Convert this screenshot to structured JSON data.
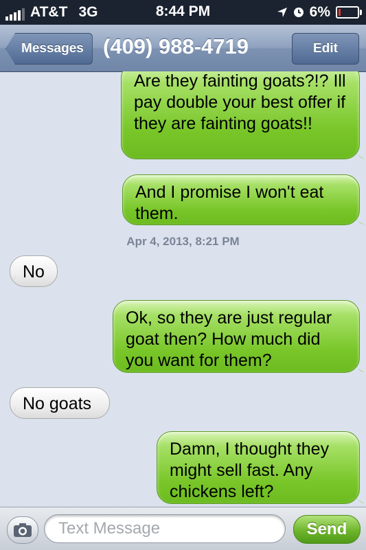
{
  "status_bar": {
    "carrier": "AT&T",
    "network": "3G",
    "time": "8:44 PM",
    "battery": "6%",
    "icons": [
      "signal-bars-icon",
      "location-arrow-icon",
      "alarm-clock-icon",
      "battery-icon"
    ]
  },
  "nav": {
    "back_label": "Messages",
    "title": "(409) 988-4719",
    "edit_label": "Edit"
  },
  "conversation": {
    "messages": [
      {
        "direction": "outgoing",
        "text": "Are they fainting goats?!? Ill pay double your best offer if they are fainting goats!!"
      },
      {
        "direction": "outgoing",
        "text": "And I promise I won't eat them."
      },
      {
        "direction": "incoming",
        "text": "No"
      },
      {
        "direction": "outgoing",
        "text": "Ok, so they are just regular goat then? How much did you want for them?"
      },
      {
        "direction": "incoming",
        "text": "No goats"
      },
      {
        "direction": "outgoing",
        "text": "Damn, I thought they might sell fast. Any chickens left?"
      }
    ],
    "timestamp": "Apr 4, 2013, 8:21 PM"
  },
  "input_bar": {
    "placeholder": "Text Message",
    "value": "",
    "send_label": "Send",
    "camera_icon": "camera-icon"
  },
  "colors": {
    "outgoing_bubble": "#79c629",
    "incoming_bubble": "#eeeeee",
    "background": "#dbe2ed",
    "nav_bar": "#8fa2bf",
    "status_bar": "#1b2330"
  }
}
